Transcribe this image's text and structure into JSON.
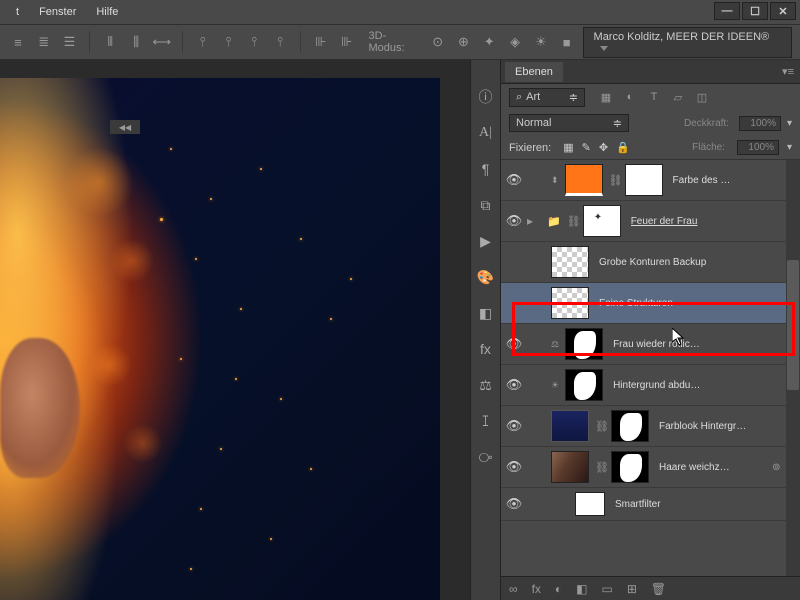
{
  "menu": {
    "items": [
      "t",
      "Fenster",
      "Hilfe"
    ]
  },
  "toolbar": {
    "mode_label": "3D-Modus:",
    "author": "Marco Kolditz, MEER DER IDEEN®"
  },
  "panel": {
    "tab": "Ebenen",
    "search_label": "Art",
    "blend_mode": "Normal",
    "opacity_label": "Deckkraft:",
    "opacity_value": "100%",
    "lock_label": "Fixieren:",
    "fill_label": "Fläche:",
    "fill_value": "100%"
  },
  "layers": [
    {
      "name": "Farbe des …",
      "visible": true,
      "type": "color",
      "linked": true
    },
    {
      "name": "Feuer der Frau",
      "visible": true,
      "type": "group",
      "underline": true
    },
    {
      "name": "Grobe Konturen Backup",
      "visible": false,
      "type": "checker"
    },
    {
      "name": "Feine Strukturen",
      "visible": false,
      "type": "checker",
      "selected": true
    },
    {
      "name": "Frau wieder rötlic…",
      "visible": true,
      "type": "mask"
    },
    {
      "name": "Hintergrund abdu…",
      "visible": true,
      "type": "mask"
    },
    {
      "name": "Farblook Hintergr…",
      "visible": true,
      "type": "navy"
    },
    {
      "name": "Haare weichz…",
      "visible": true,
      "type": "photo",
      "fx": true
    },
    {
      "name": "Smartfilter",
      "visible": true,
      "type": "smartfilter"
    }
  ],
  "bottom_icons": [
    "∞",
    "fx",
    "◐",
    "◧",
    "▭",
    "⊞",
    "🗑"
  ]
}
